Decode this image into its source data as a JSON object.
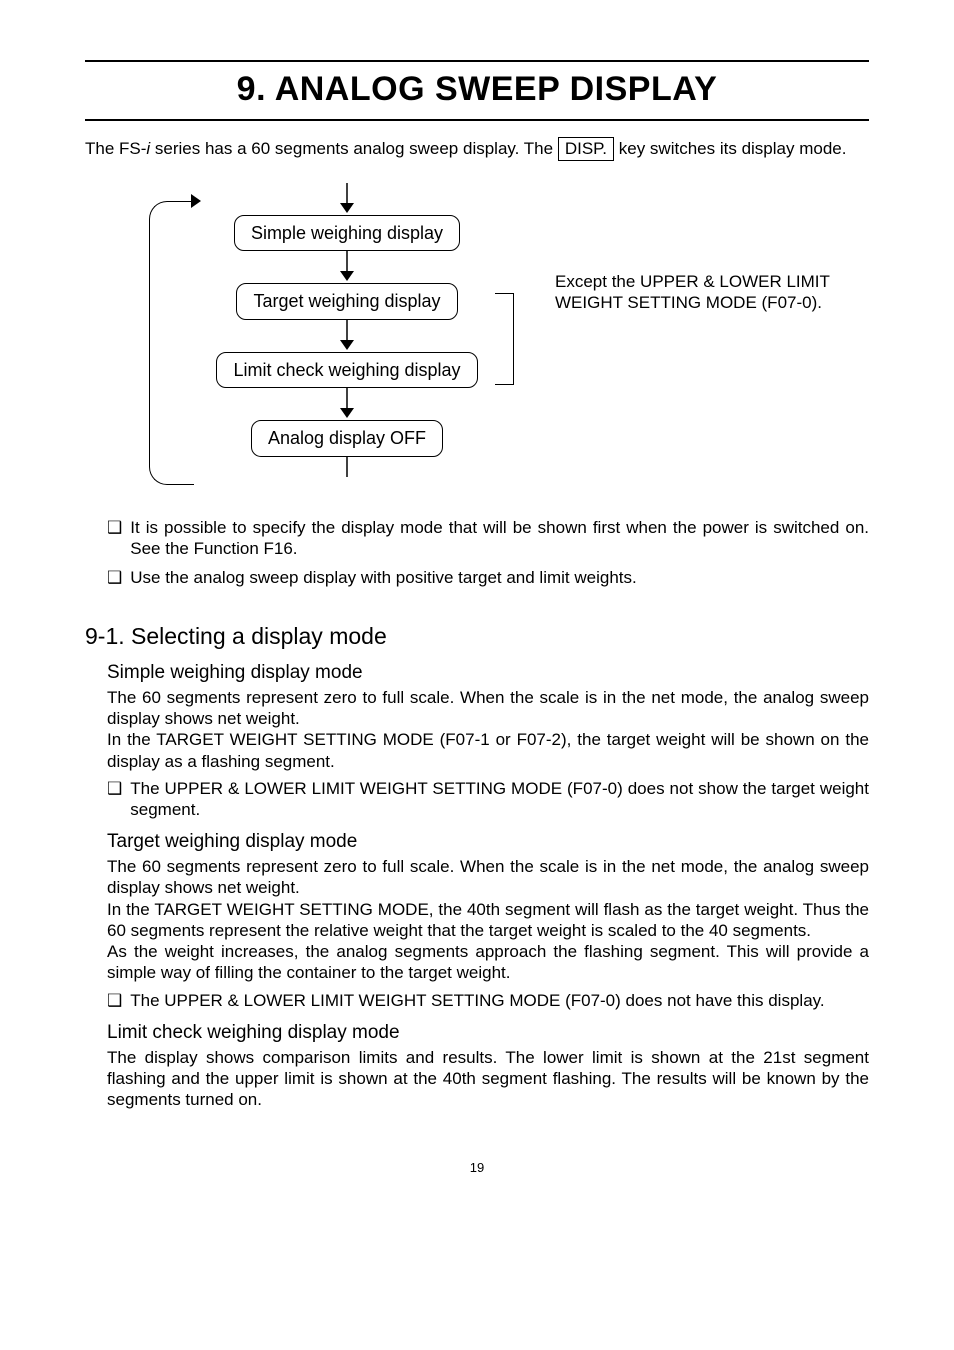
{
  "title": "9. ANALOG SWEEP DISPLAY",
  "intro": {
    "pre": "The FS-",
    "italic": "i",
    "mid": " series has a 60 segments analog sweep display. The ",
    "key": " DISP. ",
    "post": " key switches its display mode."
  },
  "flow": {
    "box1": "Simple weighing display",
    "box2": "Target weighing display",
    "box3": "Limit check weighing display",
    "box4": "Analog display OFF",
    "sidenote": "Except the UPPER & LOWER LIMIT WEIGHT SETTING MODE (F07-0)."
  },
  "bullets": {
    "b1": "It is possible to specify the display mode that will be shown first when the power is switched on. See the Function F16.",
    "b2": "Use the analog sweep display with positive target and limit weights."
  },
  "section": "9-1. Selecting a display mode",
  "simple": {
    "head": "Simple weighing display mode",
    "p1": "The 60 segments represent zero to full scale. When the scale is in the net mode, the analog sweep display shows net weight.",
    "p2": "In the TARGET WEIGHT SETTING MODE (F07-1 or F07-2), the target weight will be shown on the display as a flashing segment.",
    "bullet": "The UPPER & LOWER LIMIT WEIGHT SETTING MODE (F07-0) does not show the target weight segment."
  },
  "target": {
    "head": "Target weighing display mode",
    "p1": "The 60 segments represent zero to full scale. When the scale is in the net mode, the analog sweep display shows net weight.",
    "p2": "In the TARGET WEIGHT SETTING MODE, the 40th segment will flash as the target weight. Thus the 60 segments represent the relative weight that the target weight is scaled to the 40 segments.",
    "p3": "As the weight increases, the analog segments approach the flashing segment. This will provide a simple way of filling the container to the target weight.",
    "bullet": "The UPPER & LOWER LIMIT WEIGHT SETTING MODE (F07-0) does not have this display."
  },
  "limit": {
    "head": "Limit check weighing display mode",
    "p1": "The display shows comparison limits and results. The lower limit is shown at the 21st segment flashing and the upper limit is shown at the 40th segment flashing. The results will be known by the segments turned on."
  },
  "pagenum": "19"
}
